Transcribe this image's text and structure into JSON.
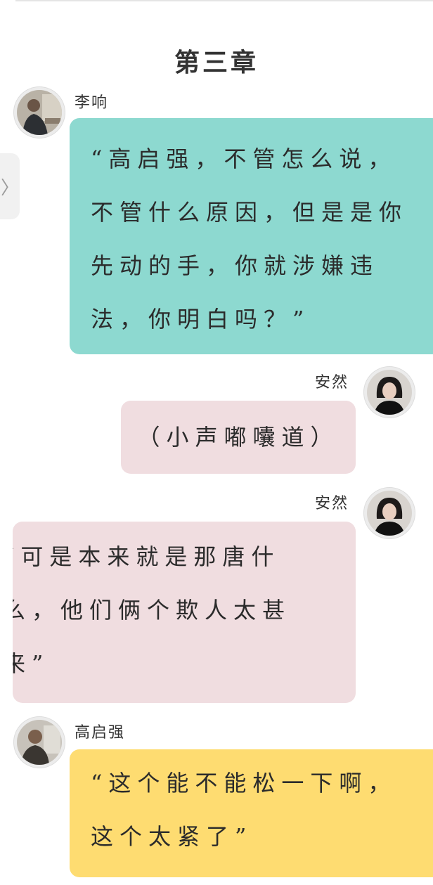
{
  "chapter": {
    "title": "第三章"
  },
  "side_tab": {
    "icon": "chevron-right-icon",
    "glyph": "〉"
  },
  "messages": [
    {
      "speaker": "李响",
      "side": "left",
      "avatar": "male-avatar",
      "color": "#8dd9d0",
      "text": "“高启强，不管怎么说，不管什么原因，但是是你先动的手，你就涉嫌违法，你明白吗？”"
    },
    {
      "speaker": "安然",
      "side": "right",
      "avatar": "female-avatar",
      "color": "#f0dde0",
      "text": "（小声嘟囔道）"
    },
    {
      "speaker": "安然",
      "side": "right",
      "avatar": "female-avatar",
      "color": "#f0dde0",
      "text": "“可是本来就是那唐什么，他们俩个欺人太甚来”"
    },
    {
      "speaker": "高启强",
      "side": "left",
      "avatar": "male-avatar",
      "color": "#fedc71",
      "text": "“这个能不能松一下啊，这个太紧了”"
    }
  ]
}
